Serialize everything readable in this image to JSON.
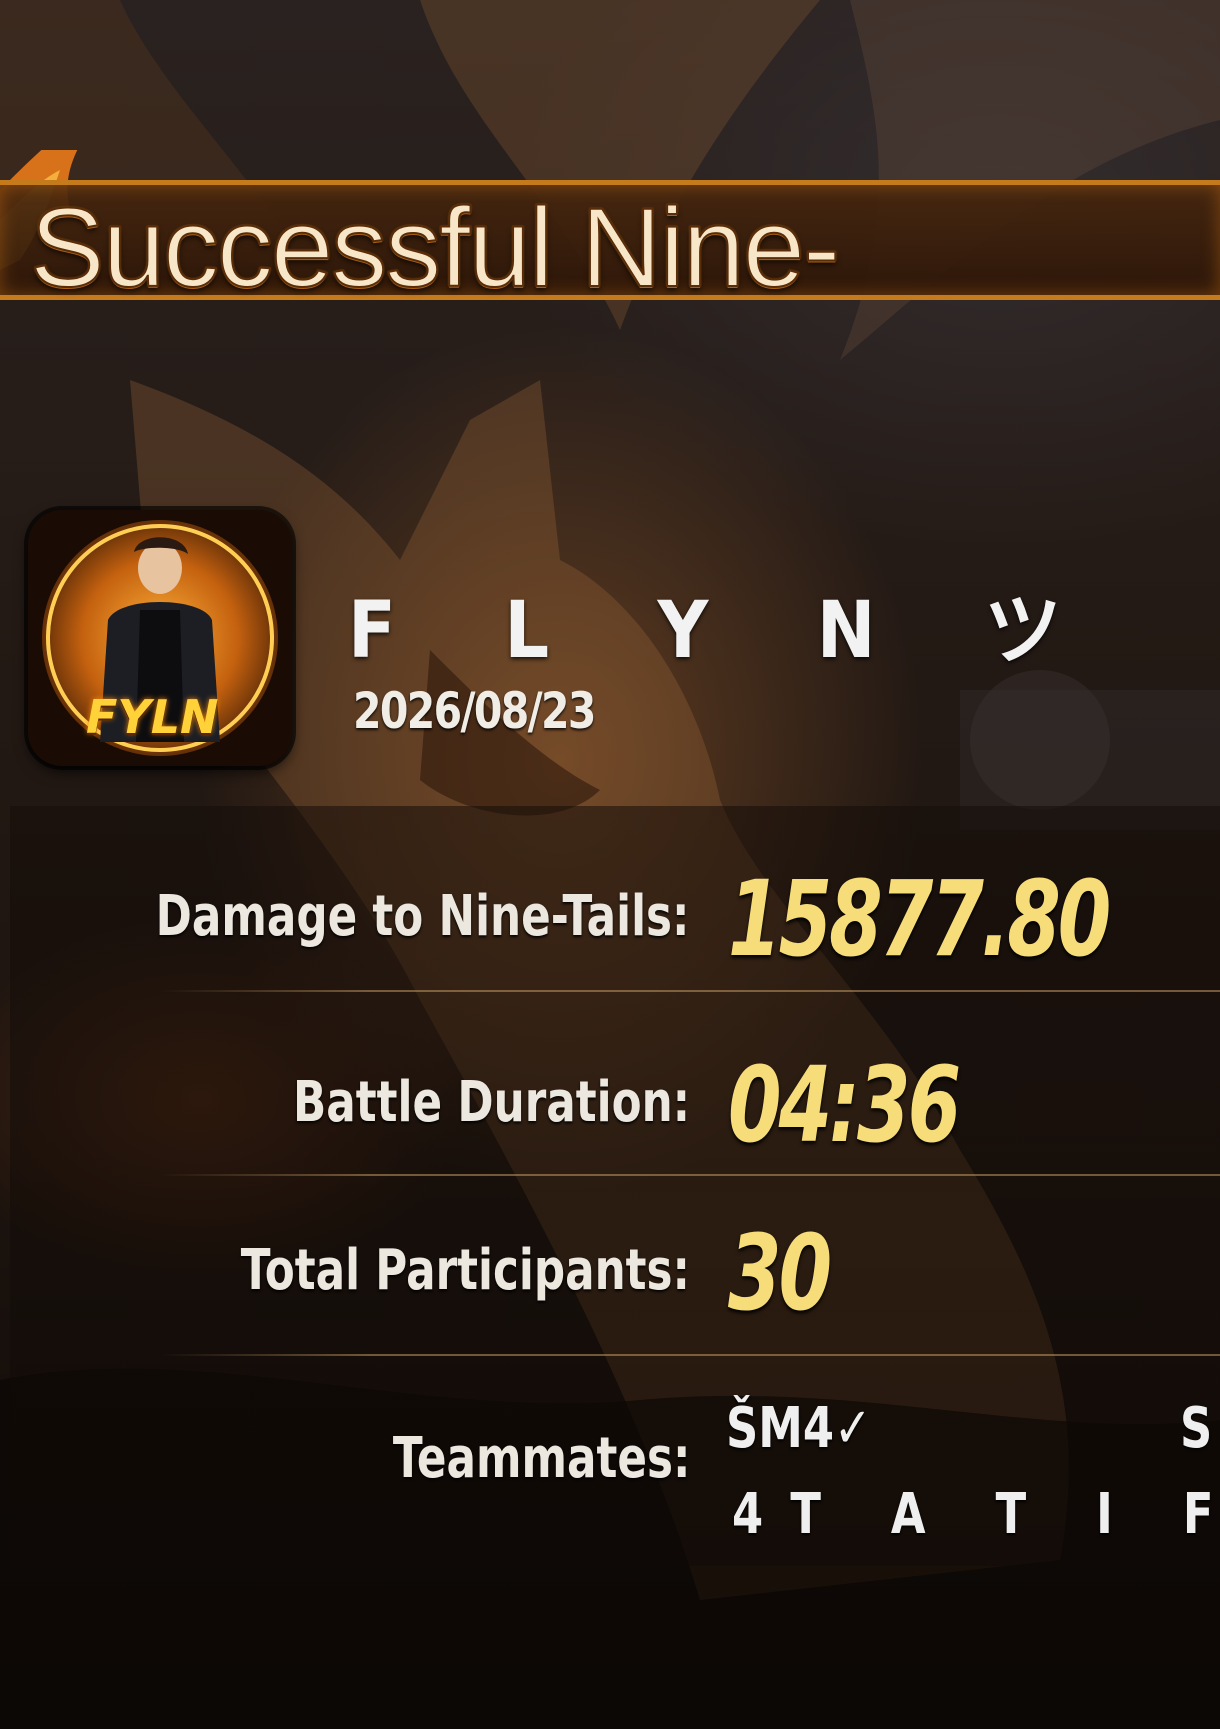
{
  "banner": {
    "title": "Successful Nine-"
  },
  "player": {
    "name": "F L Y N ツ",
    "date": "2026/08/23",
    "avatar_text": "FYLN"
  },
  "stats": {
    "damage_label": "Damage to Nine-Tails:",
    "damage_value": "15877.80",
    "duration_label": "Battle Duration:",
    "duration_value": "04:36",
    "participants_label": "Total Participants:",
    "participants_value": "30",
    "teammates_label": "Teammates:",
    "teammates": [
      "ŠM4✓",
      "S",
      "4T A T I F"
    ]
  },
  "colors": {
    "value_gold": "#f7dc7a",
    "banner_border": "#c57a1c",
    "label_white": "#ece7df"
  }
}
